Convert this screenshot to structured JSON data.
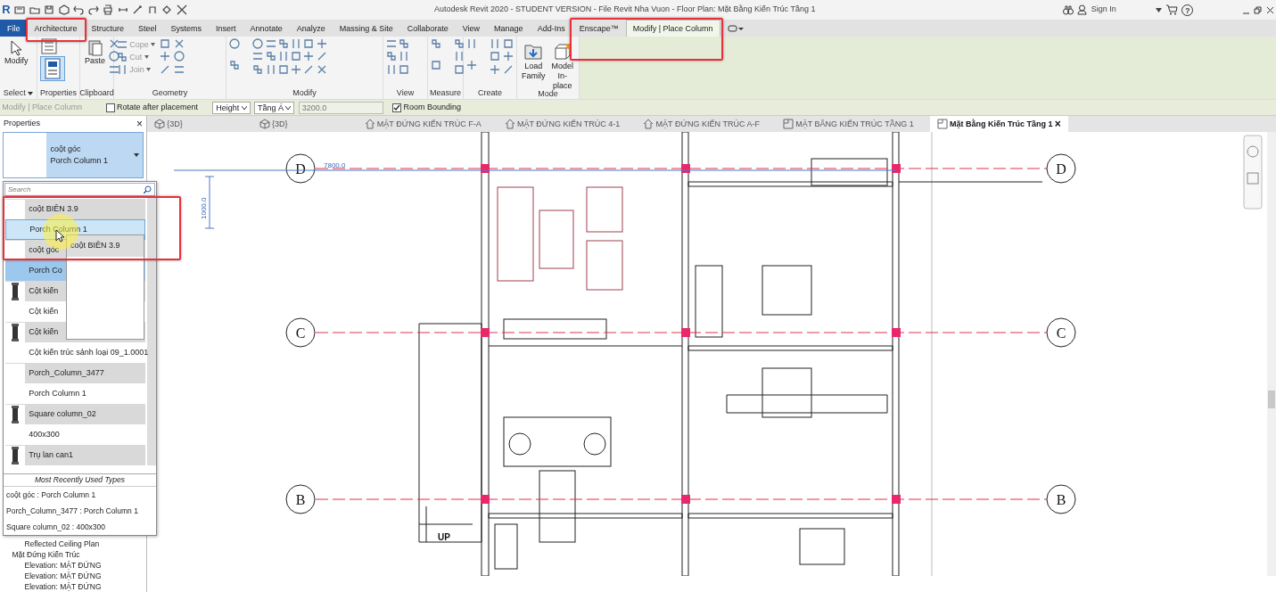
{
  "title_bar": {
    "app_letter": "R",
    "title": "Autodesk Revit 2020 - STUDENT VERSION - File Revit Nha Vuon - Floor Plan: Mặt Bằng Kiến Trúc Tầng 1",
    "sign_in": "Sign In",
    "help": "?"
  },
  "ribbon_tabs": [
    {
      "label": "File",
      "kind": "file",
      "selected": false
    },
    {
      "label": "Architecture",
      "kind": "tab",
      "selected": false
    },
    {
      "label": "Structure",
      "kind": "tab",
      "selected": false
    },
    {
      "label": "Steel",
      "kind": "tab",
      "selected": false
    },
    {
      "label": "Systems",
      "kind": "tab",
      "selected": false
    },
    {
      "label": "Insert",
      "kind": "tab",
      "selected": false
    },
    {
      "label": "Annotate",
      "kind": "tab",
      "selected": false
    },
    {
      "label": "Analyze",
      "kind": "tab",
      "selected": false
    },
    {
      "label": "Massing & Site",
      "kind": "tab",
      "selected": false
    },
    {
      "label": "Collaborate",
      "kind": "tab",
      "selected": false
    },
    {
      "label": "View",
      "kind": "tab",
      "selected": false
    },
    {
      "label": "Manage",
      "kind": "tab",
      "selected": false
    },
    {
      "label": "Add-Ins",
      "kind": "tab",
      "selected": false
    },
    {
      "label": "Enscape™",
      "kind": "tab",
      "selected": false
    },
    {
      "label": "Modify | Place Column",
      "kind": "contextual",
      "selected": true
    }
  ],
  "ribbon_panels": [
    {
      "label": "Select",
      "menu": true,
      "buttons": [
        {
          "label": "Modify"
        }
      ]
    },
    {
      "label": "Properties",
      "menu": false
    },
    {
      "label": "Clipboard",
      "menu": false,
      "buttons": [
        {
          "label": "Paste"
        }
      ]
    },
    {
      "label": "Geometry",
      "menu": false,
      "buttons": [
        {
          "label": "Cope"
        },
        {
          "label": "Cut"
        },
        {
          "label": "Join"
        }
      ]
    },
    {
      "label": "Modify",
      "menu": false
    },
    {
      "label": "View",
      "menu": false
    },
    {
      "label": "Measure",
      "menu": false
    },
    {
      "label": "Create",
      "menu": false
    },
    {
      "label": "Mode",
      "menu": false,
      "buttons": [
        {
          "label": "Load Family"
        },
        {
          "label": "Model In-place"
        }
      ]
    }
  ],
  "options_bar": {
    "context": "Modify | Place Column",
    "rotate": {
      "label": "Rotate after placement",
      "checked": false
    },
    "height_mode": "Height",
    "level": "Tầng Á",
    "height_value": "3200.0",
    "room_bounding": {
      "label": "Room Bounding",
      "checked": true
    }
  },
  "properties": {
    "title": "Properties",
    "close": "×",
    "family": "coột góc",
    "type": "Porch Column 1",
    "search_placeholder": "Search",
    "items": [
      {
        "label": "coột BIÊN 3.9",
        "kind": "family",
        "selected": false,
        "hovered": false
      },
      {
        "label": "Porch Column 1",
        "kind": "type",
        "selected": false,
        "hovered": true
      },
      {
        "label": "coột góc",
        "kind": "family",
        "selected": false,
        "hovered": false
      },
      {
        "label": "Porch Co",
        "kind": "type",
        "selected": true,
        "hovered": false
      },
      {
        "label": "Cột kiến",
        "kind": "family",
        "selected": false,
        "hovered": false
      },
      {
        "label": "Cột kiến",
        "kind": "type",
        "selected": false,
        "hovered": false
      },
      {
        "label": "Cột kiến",
        "kind": "family",
        "selected": false,
        "hovered": false
      },
      {
        "label": "Cột kiến trúc sảnh loại 09_1.0001",
        "kind": "type",
        "selected": false,
        "hovered": false
      },
      {
        "label": "Porch_Column_3477",
        "kind": "family",
        "selected": false,
        "hovered": false
      },
      {
        "label": "Porch Column 1",
        "kind": "type",
        "selected": false,
        "hovered": false
      },
      {
        "label": "Square column_02",
        "kind": "family",
        "selected": false,
        "hovered": false
      },
      {
        "label": "400x300",
        "kind": "type",
        "selected": false,
        "hovered": false
      },
      {
        "label": "Trụ lan can1",
        "kind": "family",
        "selected": false,
        "hovered": false
      }
    ],
    "drag_preview": "coột BIÊN 3.9",
    "recent_title": "Most Recently Used Types",
    "recent": [
      "coột góc : Porch Column 1",
      "Porch_Column_3477 : Porch Column 1",
      "Square column_02 : 400x300"
    ]
  },
  "project_browser": [
    {
      "label": "Reflected Ceiling Plan",
      "kind": "leaf"
    },
    {
      "label": "Mặt Đứng Kiến Trúc",
      "kind": "group"
    },
    {
      "label": "Elevation: MẶT ĐỨNG",
      "kind": "leaf"
    },
    {
      "label": "Elevation: MẶT ĐỨNG",
      "kind": "leaf"
    },
    {
      "label": "Elevation: MẶT ĐỨNG",
      "kind": "leaf"
    }
  ],
  "view_tabs": [
    {
      "label": "{3D}",
      "kind": "model",
      "selected": false
    },
    {
      "label": "{3D}",
      "kind": "model",
      "selected": false
    },
    {
      "label": "MẶT ĐỨNG KIẾN TRÚC F-A",
      "kind": "elevation",
      "selected": false
    },
    {
      "label": "MẶT ĐỨNG KIẾN TRÚC 4-1",
      "kind": "elevation",
      "selected": false
    },
    {
      "label": "MẶT ĐỨNG KIẾN TRÚC A-F",
      "kind": "elevation",
      "selected": false
    },
    {
      "label": "MẶT BẰNG KIẾN TRÚC TẦNG 1",
      "kind": "plan",
      "selected": false
    },
    {
      "label": "Mặt Bằng Kiến Trúc Tầng 1",
      "kind": "plan",
      "selected": true
    }
  ],
  "view_tab_close": "×",
  "plan": {
    "grids": [
      {
        "left": "D",
        "right": "D"
      },
      {
        "left": "C",
        "right": "C"
      },
      {
        "left": "B",
        "right": "B"
      }
    ],
    "dim_horizontal": "7800.0",
    "dim_vertical": "1000.0",
    "stair_label": "UP"
  }
}
